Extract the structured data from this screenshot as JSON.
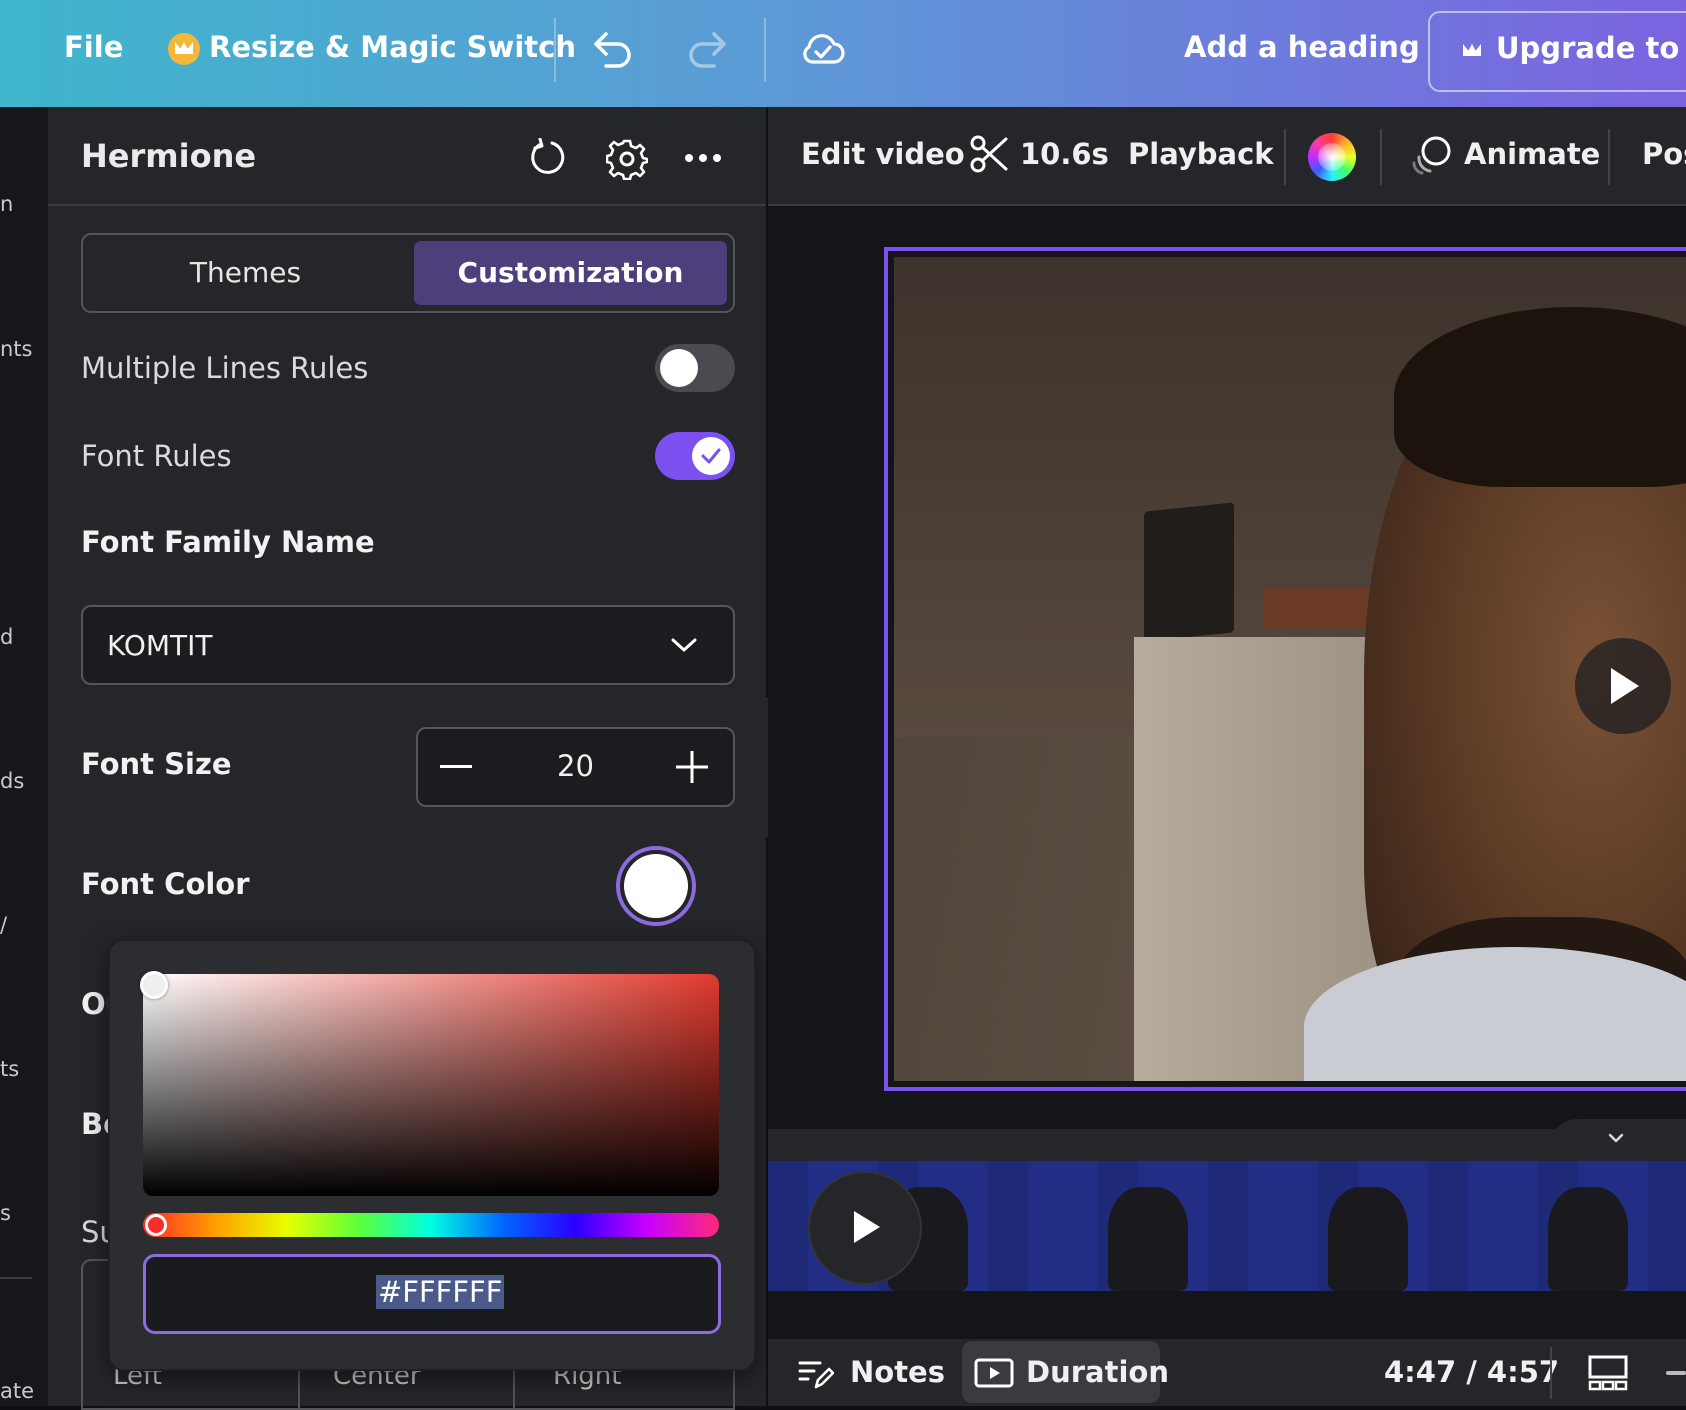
{
  "topbar": {
    "file": "File",
    "resize": "Resize & Magic Switch",
    "add_heading": "Add a heading",
    "upgrade": "Upgrade to Ca"
  },
  "left_strip": [
    "n",
    "nts",
    "d",
    "ds",
    "/",
    "ts",
    "s",
    "ate"
  ],
  "panel": {
    "title": "Hermione",
    "tabs": [
      "Themes",
      "Customization"
    ],
    "active_tab": "Customization",
    "multiple_lines_rules": {
      "label": "Multiple Lines Rules",
      "on": false
    },
    "font_rules": {
      "label": "Font Rules",
      "on": true
    },
    "font_family_label": "Font Family Name",
    "font_family_value": "KOMTIT",
    "font_size_label": "Font Size",
    "font_size_value": "20",
    "font_color_label": "Font Color",
    "hidden_labels": [
      "Ou",
      "Bo",
      "Su"
    ],
    "alignment_partial": [
      "Left",
      "Center",
      "Right"
    ]
  },
  "color_picker": {
    "hex": "#FFFFFF",
    "base_hue_color": "#e23a2e"
  },
  "video_toolbar": {
    "edit_video": "Edit video",
    "duration": "10.6s",
    "playback": "Playback",
    "animate": "Animate",
    "position": "Pos"
  },
  "footer": {
    "notes": "Notes",
    "duration": "Duration",
    "time": "4:47 / 4:57"
  },
  "colors": {
    "accent": "#7c4ff0",
    "toggle_on": "#7c4ff0",
    "panel_bg": "#25262a"
  }
}
